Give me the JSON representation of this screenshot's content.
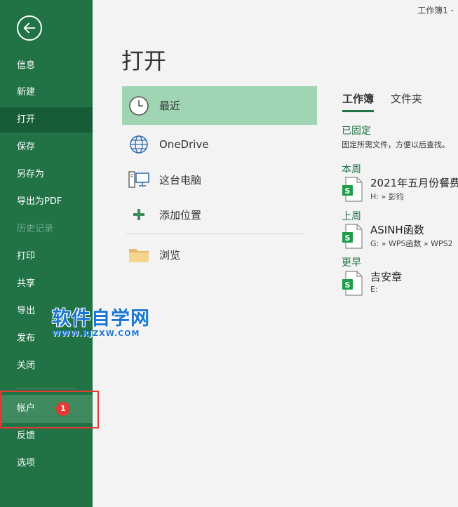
{
  "window": {
    "title": "工作簿1  -"
  },
  "sidebar": {
    "items": [
      {
        "label": "信息"
      },
      {
        "label": "新建"
      },
      {
        "label": "打开"
      },
      {
        "label": "保存"
      },
      {
        "label": "另存为"
      },
      {
        "label": "导出为PDF"
      },
      {
        "label": "历史记录"
      },
      {
        "label": "打印"
      },
      {
        "label": "共享"
      },
      {
        "label": "导出"
      },
      {
        "label": "发布"
      },
      {
        "label": "关闭"
      },
      {
        "label": "帐户"
      },
      {
        "label": "反馈"
      },
      {
        "label": "选项"
      }
    ],
    "badge": "1"
  },
  "watermark": {
    "text": "软件自学网",
    "url": "WWW.RJZXW.COM"
  },
  "main": {
    "title": "打开",
    "locations": [
      {
        "label": "最近",
        "icon": "clock-icon"
      },
      {
        "label": "OneDrive",
        "icon": "globe-icon"
      },
      {
        "label": "这台电脑",
        "icon": "computer-icon"
      },
      {
        "label": "添加位置",
        "icon": "plus-icon"
      },
      {
        "label": "浏览",
        "icon": "folder-icon"
      }
    ]
  },
  "recent": {
    "tabs": [
      {
        "label": "工作簿"
      },
      {
        "label": "文件夹"
      }
    ],
    "pinned": {
      "title": "已固定",
      "desc": "固定所需文件，方便以后查找。"
    },
    "groups": [
      {
        "title": "本周",
        "files": [
          {
            "name": "2021年五月份餐费",
            "path": "H: » 彭钧"
          }
        ]
      },
      {
        "title": "上周",
        "files": [
          {
            "name": "ASINH函数",
            "path": "G: » WPS函数 » WPS2"
          }
        ]
      },
      {
        "title": "更早",
        "files": [
          {
            "name": "吉安章",
            "path": "E:"
          }
        ]
      }
    ]
  },
  "colors": {
    "sidebar": "#217346",
    "active_location": "#a0d5b3",
    "accent": "#217346",
    "highlight": "#e53935"
  }
}
